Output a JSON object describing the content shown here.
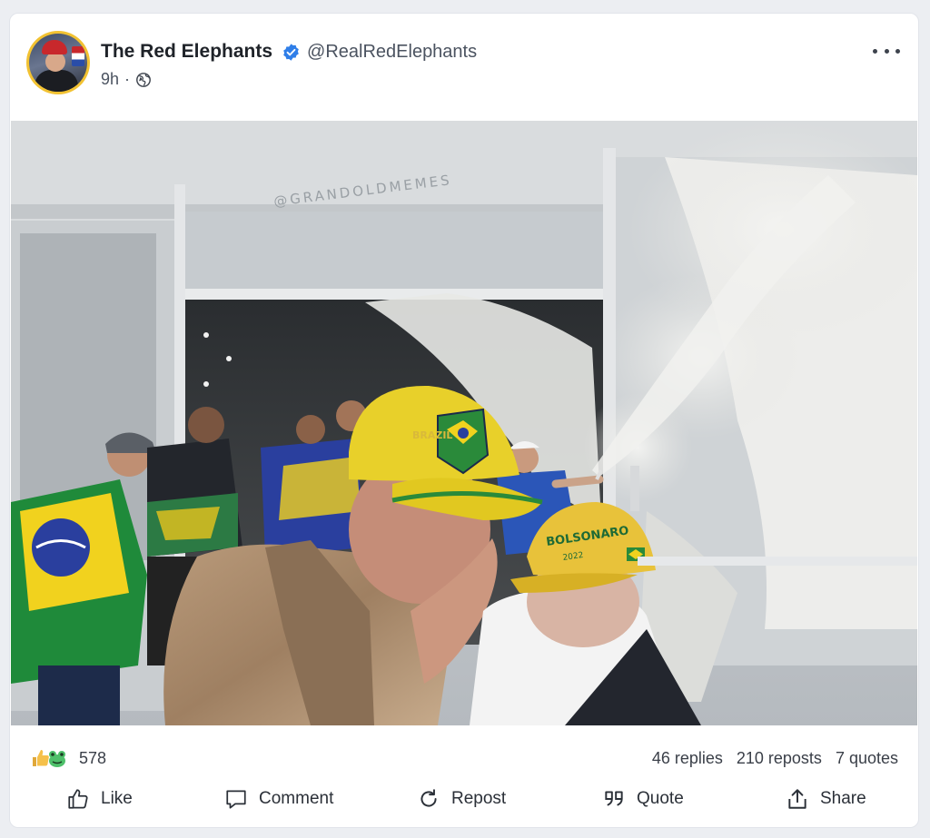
{
  "post": {
    "author_name": "The Red Elephants",
    "handle": "@RealRedElephants",
    "time": "9h",
    "separator": "·",
    "verified": true,
    "visibility_icon": "globe-icon",
    "accent_color": "#f2c232",
    "verified_color": "#2f7ee8"
  },
  "media": {
    "watermark": "@GRANDOLDMEMES",
    "cap_text_left": "BRAZIL",
    "cap_text_right": "BOLSONARO",
    "cap_year": "2022"
  },
  "stats": {
    "reaction_icons": [
      "thumbs-up-icon",
      "frog-icon"
    ],
    "reaction_count": "578",
    "replies": "46 replies",
    "reposts": "210 reposts",
    "quotes": "7 quotes"
  },
  "actions": {
    "like": "Like",
    "comment": "Comment",
    "repost": "Repost",
    "quote": "Quote",
    "share": "Share"
  }
}
